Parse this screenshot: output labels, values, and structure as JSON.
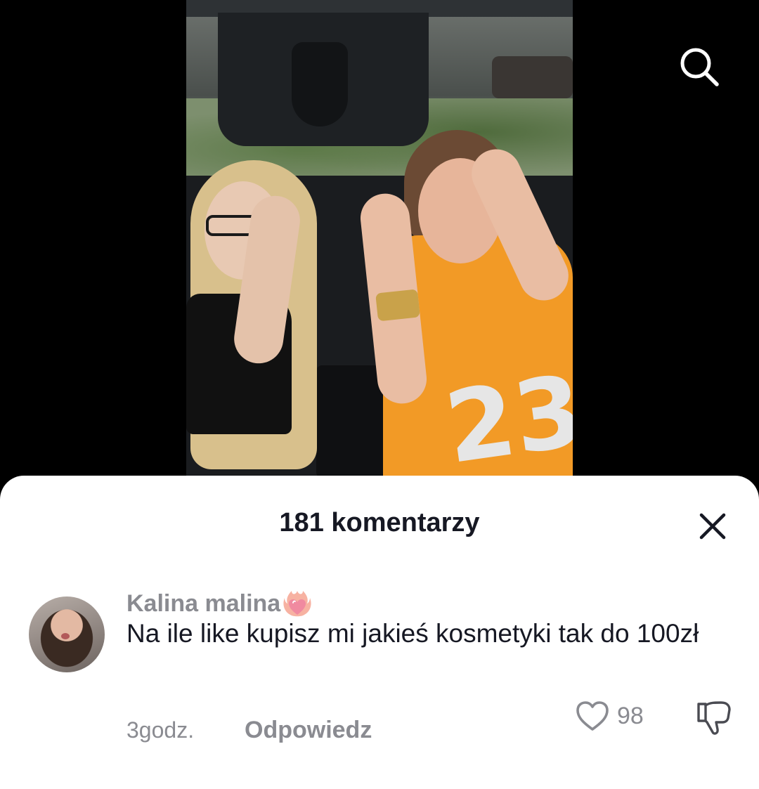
{
  "header": {
    "search_icon": "search-icon"
  },
  "comments_sheet": {
    "title": "181 komentarzy",
    "close_icon": "close-icon"
  },
  "comment": {
    "username": "Kalina malina",
    "username_emoji": "heart-on-fire-emoji",
    "text": "Na ile like kupisz mi jakieś kosmetyki tak do 100zł",
    "time": "3godz.",
    "reply_label": "Odpowiedz",
    "like_icon": "heart-outline-icon",
    "like_count": "98",
    "dislike_icon": "thumbs-down-icon"
  },
  "video": {
    "jersey_number": "23"
  },
  "colors": {
    "background": "#000000",
    "sheet": "#ffffff",
    "primary_text": "#161823",
    "secondary_text": "#8a8b91"
  }
}
